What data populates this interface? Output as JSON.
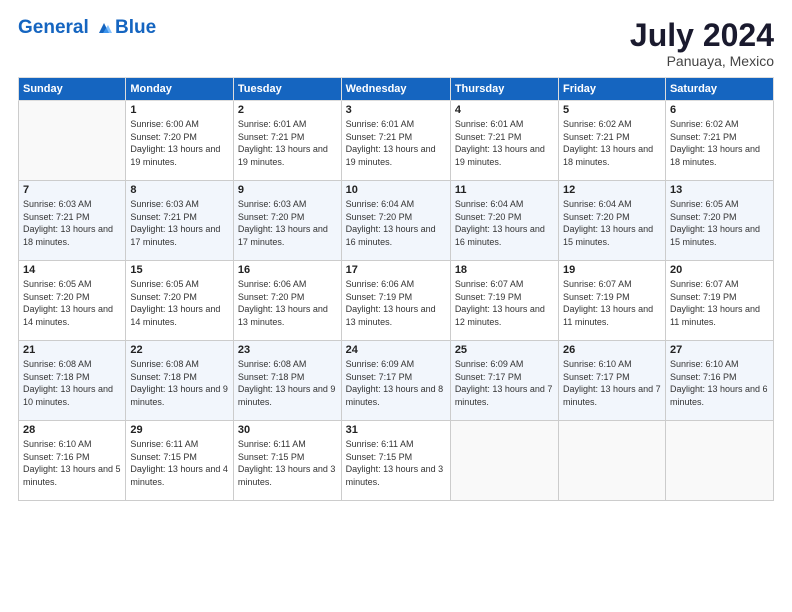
{
  "header": {
    "logo_line1": "General",
    "logo_line2": "Blue",
    "month_year": "July 2024",
    "location": "Panuaya, Mexico"
  },
  "days_of_week": [
    "Sunday",
    "Monday",
    "Tuesday",
    "Wednesday",
    "Thursday",
    "Friday",
    "Saturday"
  ],
  "weeks": [
    [
      {
        "num": "",
        "empty": true
      },
      {
        "num": "1",
        "sunrise": "Sunrise: 6:00 AM",
        "sunset": "Sunset: 7:20 PM",
        "daylight": "Daylight: 13 hours and 19 minutes."
      },
      {
        "num": "2",
        "sunrise": "Sunrise: 6:01 AM",
        "sunset": "Sunset: 7:21 PM",
        "daylight": "Daylight: 13 hours and 19 minutes."
      },
      {
        "num": "3",
        "sunrise": "Sunrise: 6:01 AM",
        "sunset": "Sunset: 7:21 PM",
        "daylight": "Daylight: 13 hours and 19 minutes."
      },
      {
        "num": "4",
        "sunrise": "Sunrise: 6:01 AM",
        "sunset": "Sunset: 7:21 PM",
        "daylight": "Daylight: 13 hours and 19 minutes."
      },
      {
        "num": "5",
        "sunrise": "Sunrise: 6:02 AM",
        "sunset": "Sunset: 7:21 PM",
        "daylight": "Daylight: 13 hours and 18 minutes."
      },
      {
        "num": "6",
        "sunrise": "Sunrise: 6:02 AM",
        "sunset": "Sunset: 7:21 PM",
        "daylight": "Daylight: 13 hours and 18 minutes."
      }
    ],
    [
      {
        "num": "7",
        "sunrise": "Sunrise: 6:03 AM",
        "sunset": "Sunset: 7:21 PM",
        "daylight": "Daylight: 13 hours and 18 minutes."
      },
      {
        "num": "8",
        "sunrise": "Sunrise: 6:03 AM",
        "sunset": "Sunset: 7:21 PM",
        "daylight": "Daylight: 13 hours and 17 minutes."
      },
      {
        "num": "9",
        "sunrise": "Sunrise: 6:03 AM",
        "sunset": "Sunset: 7:20 PM",
        "daylight": "Daylight: 13 hours and 17 minutes."
      },
      {
        "num": "10",
        "sunrise": "Sunrise: 6:04 AM",
        "sunset": "Sunset: 7:20 PM",
        "daylight": "Daylight: 13 hours and 16 minutes."
      },
      {
        "num": "11",
        "sunrise": "Sunrise: 6:04 AM",
        "sunset": "Sunset: 7:20 PM",
        "daylight": "Daylight: 13 hours and 16 minutes."
      },
      {
        "num": "12",
        "sunrise": "Sunrise: 6:04 AM",
        "sunset": "Sunset: 7:20 PM",
        "daylight": "Daylight: 13 hours and 15 minutes."
      },
      {
        "num": "13",
        "sunrise": "Sunrise: 6:05 AM",
        "sunset": "Sunset: 7:20 PM",
        "daylight": "Daylight: 13 hours and 15 minutes."
      }
    ],
    [
      {
        "num": "14",
        "sunrise": "Sunrise: 6:05 AM",
        "sunset": "Sunset: 7:20 PM",
        "daylight": "Daylight: 13 hours and 14 minutes."
      },
      {
        "num": "15",
        "sunrise": "Sunrise: 6:05 AM",
        "sunset": "Sunset: 7:20 PM",
        "daylight": "Daylight: 13 hours and 14 minutes."
      },
      {
        "num": "16",
        "sunrise": "Sunrise: 6:06 AM",
        "sunset": "Sunset: 7:20 PM",
        "daylight": "Daylight: 13 hours and 13 minutes."
      },
      {
        "num": "17",
        "sunrise": "Sunrise: 6:06 AM",
        "sunset": "Sunset: 7:19 PM",
        "daylight": "Daylight: 13 hours and 13 minutes."
      },
      {
        "num": "18",
        "sunrise": "Sunrise: 6:07 AM",
        "sunset": "Sunset: 7:19 PM",
        "daylight": "Daylight: 13 hours and 12 minutes."
      },
      {
        "num": "19",
        "sunrise": "Sunrise: 6:07 AM",
        "sunset": "Sunset: 7:19 PM",
        "daylight": "Daylight: 13 hours and 11 minutes."
      },
      {
        "num": "20",
        "sunrise": "Sunrise: 6:07 AM",
        "sunset": "Sunset: 7:19 PM",
        "daylight": "Daylight: 13 hours and 11 minutes."
      }
    ],
    [
      {
        "num": "21",
        "sunrise": "Sunrise: 6:08 AM",
        "sunset": "Sunset: 7:18 PM",
        "daylight": "Daylight: 13 hours and 10 minutes."
      },
      {
        "num": "22",
        "sunrise": "Sunrise: 6:08 AM",
        "sunset": "Sunset: 7:18 PM",
        "daylight": "Daylight: 13 hours and 9 minutes."
      },
      {
        "num": "23",
        "sunrise": "Sunrise: 6:08 AM",
        "sunset": "Sunset: 7:18 PM",
        "daylight": "Daylight: 13 hours and 9 minutes."
      },
      {
        "num": "24",
        "sunrise": "Sunrise: 6:09 AM",
        "sunset": "Sunset: 7:17 PM",
        "daylight": "Daylight: 13 hours and 8 minutes."
      },
      {
        "num": "25",
        "sunrise": "Sunrise: 6:09 AM",
        "sunset": "Sunset: 7:17 PM",
        "daylight": "Daylight: 13 hours and 7 minutes."
      },
      {
        "num": "26",
        "sunrise": "Sunrise: 6:10 AM",
        "sunset": "Sunset: 7:17 PM",
        "daylight": "Daylight: 13 hours and 7 minutes."
      },
      {
        "num": "27",
        "sunrise": "Sunrise: 6:10 AM",
        "sunset": "Sunset: 7:16 PM",
        "daylight": "Daylight: 13 hours and 6 minutes."
      }
    ],
    [
      {
        "num": "28",
        "sunrise": "Sunrise: 6:10 AM",
        "sunset": "Sunset: 7:16 PM",
        "daylight": "Daylight: 13 hours and 5 minutes."
      },
      {
        "num": "29",
        "sunrise": "Sunrise: 6:11 AM",
        "sunset": "Sunset: 7:15 PM",
        "daylight": "Daylight: 13 hours and 4 minutes."
      },
      {
        "num": "30",
        "sunrise": "Sunrise: 6:11 AM",
        "sunset": "Sunset: 7:15 PM",
        "daylight": "Daylight: 13 hours and 3 minutes."
      },
      {
        "num": "31",
        "sunrise": "Sunrise: 6:11 AM",
        "sunset": "Sunset: 7:15 PM",
        "daylight": "Daylight: 13 hours and 3 minutes."
      },
      {
        "num": "",
        "empty": true
      },
      {
        "num": "",
        "empty": true
      },
      {
        "num": "",
        "empty": true
      }
    ]
  ]
}
